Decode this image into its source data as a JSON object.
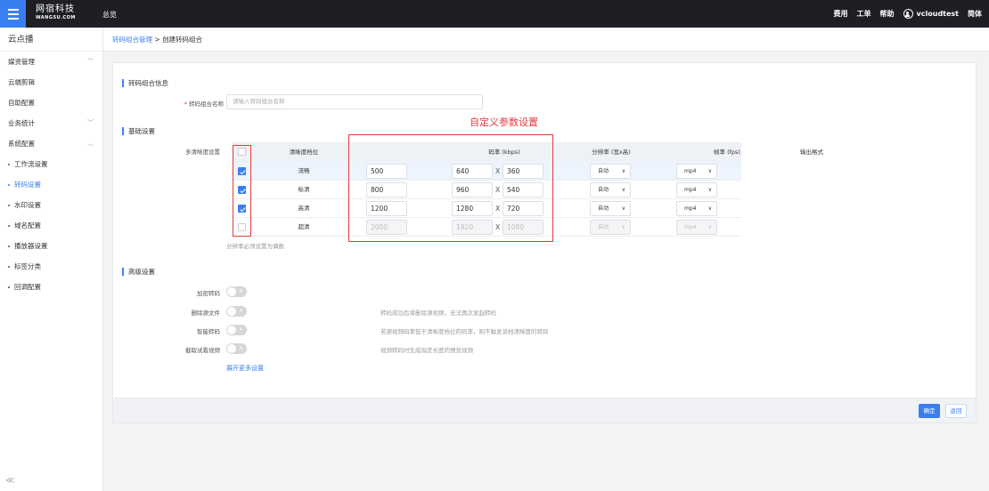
{
  "topbar": {
    "logo_cn": "网宿科技",
    "logo_en": "WANGSU.COM",
    "overview": "总览",
    "right": [
      "费用",
      "工单",
      "帮助"
    ],
    "user": "vcloudtest",
    "lang": "简体"
  },
  "sidebar": {
    "title": "云点播",
    "items": [
      {
        "label": "媒资管理",
        "chevron": "﹀"
      },
      {
        "label": "云端剪辑",
        "chevron": ""
      },
      {
        "label": "自助配置",
        "chevron": ""
      },
      {
        "label": "业务统计",
        "chevron": "﹀"
      },
      {
        "label": "系统配置",
        "chevron": "︿"
      }
    ],
    "subs": [
      "工作流设置",
      "转码设置",
      "水印设置",
      "域名配置",
      "播放器设置",
      "标签分类",
      "回调配置"
    ],
    "collapse": "≪"
  },
  "breadcrumb": {
    "parent": "转码组合管理",
    "sep": " > ",
    "current": "创建转码组合"
  },
  "info": {
    "section_title": "转码组合信息",
    "name_label": "转码组合名称",
    "name_placeholder": "请输入转码组合名称"
  },
  "basic": {
    "section_title": "基础设置",
    "multi_label": "多清晰度设置",
    "headers": {
      "level": "清晰度档位",
      "bitrate": "码率 (kbps)",
      "resolution": "分辨率 (宽x高)",
      "fps": "帧率 (fps)",
      "format": "输出格式"
    },
    "rows": [
      {
        "checked": true,
        "level": "流畅",
        "bitrate": "500",
        "width": "640",
        "height": "360",
        "fps": "自动",
        "format": "mp4",
        "disabled": false
      },
      {
        "checked": true,
        "level": "标清",
        "bitrate": "800",
        "width": "960",
        "height": "540",
        "fps": "自动",
        "format": "mp4",
        "disabled": false
      },
      {
        "checked": true,
        "level": "高清",
        "bitrate": "1200",
        "width": "1280",
        "height": "720",
        "fps": "自动",
        "format": "mp4",
        "disabled": false
      },
      {
        "checked": false,
        "level": "超清",
        "bitrate": "2000",
        "width": "1920",
        "height": "1080",
        "fps": "自动",
        "format": "mp4",
        "disabled": true
      }
    ],
    "x_sep": "X",
    "note": "分辨率必须设置为偶数",
    "annotation": "自定义参数设置"
  },
  "advanced": {
    "section_title": "高级设置",
    "options": [
      {
        "label": "加密转码",
        "desc": ""
      },
      {
        "label": "删除源文件",
        "desc": "转码成功后将删除源视频，无法再次发起转码"
      },
      {
        "label": "智能转码",
        "desc": "若源视频码率低于清晰度档位的码率，则不触发该档清晰度的转码"
      },
      {
        "label": "截取试看视频",
        "desc": "视频转码时生成指定长度的预览视频"
      }
    ],
    "more": "展开更多设置"
  },
  "footer": {
    "confirm": "确定",
    "back": "返回"
  }
}
